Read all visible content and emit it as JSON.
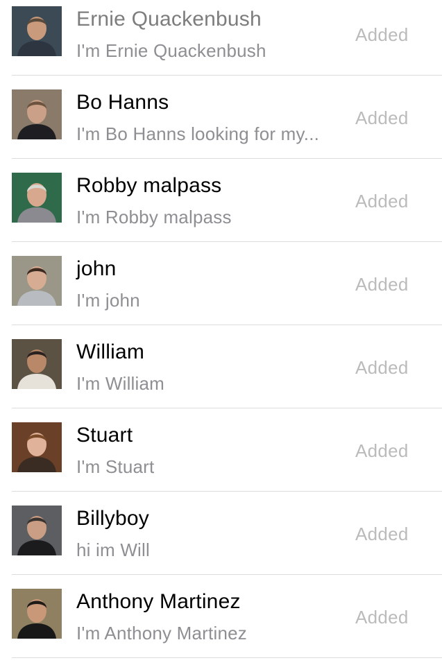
{
  "contacts": [
    {
      "name": "Ernie Quackenbush",
      "bio": "I'm Ernie Quackenbush",
      "status": "Added",
      "avatar_icon": "person-photo",
      "bg": "#3b4a55",
      "skin": "#c99b7c",
      "hair": "#5a4a3c",
      "shirt": "#2c3540"
    },
    {
      "name": "Bo Hanns",
      "bio": "I'm Bo Hanns looking for my...",
      "status": "Added",
      "avatar_icon": "person-photo",
      "bg": "#8a7a6a",
      "skin": "#caa088",
      "hair": "#6b5340",
      "shirt": "#1e1e22"
    },
    {
      "name": "Robby malpass",
      "bio": "I'm Robby malpass",
      "status": "Added",
      "avatar_icon": "person-photo",
      "bg": "#2f6b4a",
      "skin": "#d8a88e",
      "hair": "#d8d8d2",
      "shirt": "#8a8a90"
    },
    {
      "name": "john",
      "bio": "I'm john",
      "status": "Added",
      "avatar_icon": "person-photo",
      "bg": "#9a9688",
      "skin": "#d6ad92",
      "hair": "#3c2a20",
      "shirt": "#b8bcc0"
    },
    {
      "name": "William",
      "bio": "I'm William",
      "status": "Added",
      "avatar_icon": "person-photo",
      "bg": "#5b5244",
      "skin": "#b88868",
      "hair": "#2a2220",
      "shirt": "#e6e2da"
    },
    {
      "name": "Stuart",
      "bio": "I'm Stuart",
      "status": "Added",
      "avatar_icon": "person-photo",
      "bg": "#6a4028",
      "skin": "#e0b29a",
      "hair": "#7a4a28",
      "shirt": "#3a2c22"
    },
    {
      "name": "Billyboy",
      "bio": "hi im Will",
      "status": "Added",
      "avatar_icon": "person-photo",
      "bg": "#5c5e62",
      "skin": "#c99e84",
      "hair": "#3a3430",
      "shirt": "#1b1b1e"
    },
    {
      "name": "Anthony Martinez",
      "bio": "I'm Anthony Martinez",
      "status": "Added",
      "avatar_icon": "person-photo",
      "bg": "#8f8062",
      "skin": "#c89878",
      "hair": "#1e1a18",
      "shirt": "#181818"
    }
  ]
}
